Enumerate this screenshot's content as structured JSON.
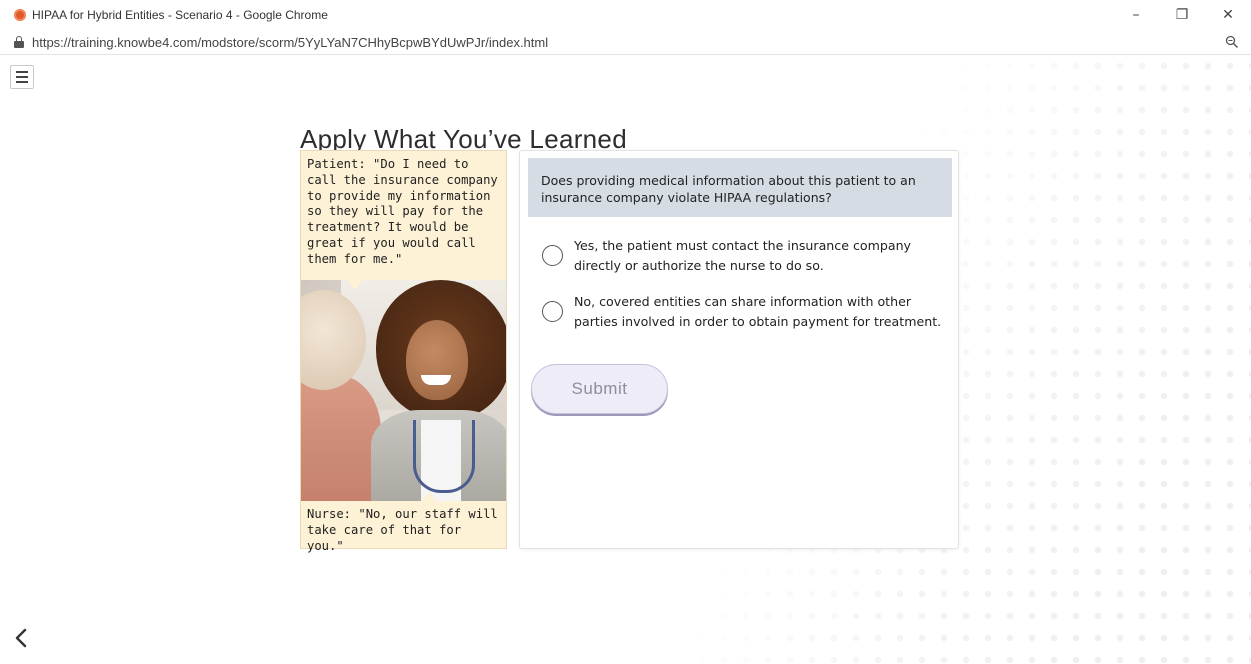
{
  "window": {
    "title": "HIPAA for Hybrid Entities - Scenario 4 - Google Chrome",
    "controls": {
      "minimize": "–",
      "restore": "❐",
      "close": "✕"
    }
  },
  "address_bar": {
    "url": "https://training.knowbe4.com/modstore/scorm/5YyLYaN7CHhyBcpwBYdUwPJr/index.html"
  },
  "page": {
    "title": "Apply What You’ve Learned"
  },
  "scenario": {
    "patient_quote": "Patient: \"Do I need to call the insurance company to provide my information so they will pay for the treatment? It would be great if you would call them for me.\"",
    "nurse_quote": "Nurse: \"No, our staff will take care of that for you.\""
  },
  "question": {
    "prompt": "Does providing medical information about this patient to an insurance company violate HIPAA regulations?",
    "options": [
      {
        "label": "Yes, the patient must contact the insurance company directly or authorize the nurse to do so.",
        "selected": false
      },
      {
        "label": "No, covered entities can share information with other parties involved in order to obtain payment for treatment.",
        "selected": false
      }
    ],
    "submit_label": "Submit"
  },
  "icons": {
    "menu": "hamburger-menu-icon",
    "back": "chevron-left-icon",
    "lock": "lock-icon",
    "zoom": "zoom-magnifier-icon",
    "app": "chrome-app-icon"
  },
  "colors": {
    "speech_bubble": "#fdf1d6",
    "question_bg": "#d5dce3",
    "submit_bg": "#eeecf7"
  }
}
